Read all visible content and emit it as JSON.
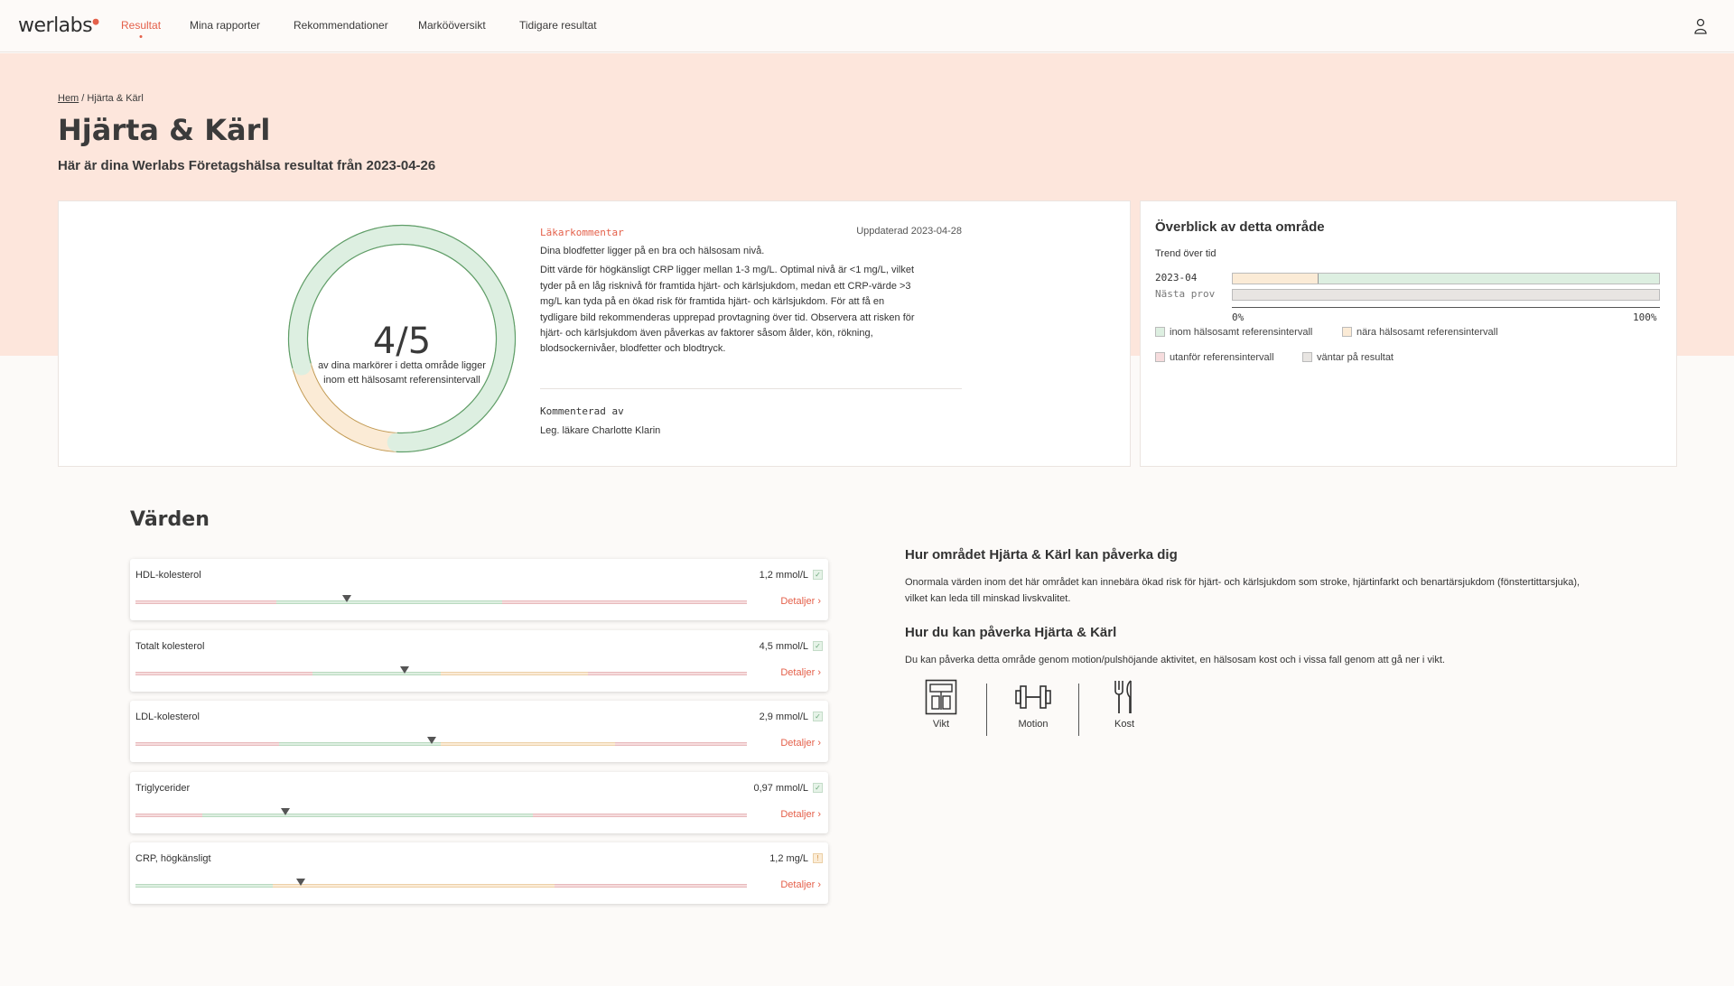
{
  "nav": {
    "logo": "werlabs",
    "items": [
      "Resultat",
      "Mina rapporter",
      "Rekommendationer",
      "Markööversikt",
      "Tidigare resultat"
    ]
  },
  "breadcrumb": {
    "home": "Hem",
    "separator": "/",
    "current": "Hjärta & Kärl"
  },
  "page": {
    "title": "Hjärta & Kärl",
    "subtitle": "Här är dina Werlabs Företagshälsa resultat från 2023-04-26"
  },
  "summary": {
    "score": "4/5",
    "score_label": "av dina markörer i detta område ligger inom ett hälsosamt referensintervall",
    "ring_fraction": 0.8
  },
  "comment": {
    "title": "Läkarkommentar",
    "updated": "Uppdaterad 2023-04-28",
    "paragraph1": "Dina blodfetter ligger på en bra och hälsosam nivå.",
    "paragraph2": "Ditt värde för högkänsligt CRP ligger mellan 1-3 mg/L. Optimal nivå är <1 mg/L, vilket tyder på en låg risknivå för framtida hjärt- och kärlsjukdom, medan ett CRP-värde >3 mg/L kan tyda på en ökad risk för framtida hjärt- och kärlsjukdom. För att få en tydligare bild rekommenderas upprepad provtagning över tid. Observera att risken för hjärt- och kärlsjukdom även påverkas av faktorer såsom ålder, kön, rökning, blodsockernivåer, blodfetter och blodtryck.",
    "by_label": "Kommenterad av",
    "doctor": "Leg. läkare Charlotte Klarin"
  },
  "overview": {
    "title": "Överblick av detta område",
    "trend_label": "Trend över tid",
    "rows": [
      {
        "label": "2023-04",
        "segments": [
          {
            "status": "near",
            "fraction": 0.2
          },
          {
            "status": "within",
            "fraction": 0.8
          }
        ]
      },
      {
        "label": "Nästa prov",
        "segments": [
          {
            "status": "pending",
            "fraction": 1.0
          }
        ]
      }
    ],
    "axis_min": "0%",
    "axis_max": "100%",
    "legend": {
      "within": "inom hälsosamt referensintervall",
      "near": "nära hälsosamt referensintervall",
      "outside": "utanför referensintervall",
      "pending": "väntar på resultat"
    },
    "colors": {
      "within": "#ddefe1",
      "near": "#fbebd6",
      "outside": "#f6dcdd",
      "pending": "#e8e5e2"
    }
  },
  "values": {
    "title": "Värden",
    "detail_label": "Detaljer",
    "items": [
      {
        "name": "HDL-kolesterol",
        "value": "1,2 mmol/L",
        "status": "ok",
        "ranges": [
          {
            "c": "r",
            "w": 0.23
          },
          {
            "c": "g",
            "w": 0.37
          },
          {
            "c": "r",
            "w": 0.4
          }
        ],
        "marker": 0.345
      },
      {
        "name": "Totalt kolesterol",
        "value": "4,5 mmol/L",
        "status": "ok",
        "ranges": [
          {
            "c": "r",
            "w": 0.29
          },
          {
            "c": "g",
            "w": 0.21
          },
          {
            "c": "o",
            "w": 0.24
          },
          {
            "c": "r",
            "w": 0.26
          }
        ],
        "marker": 0.44
      },
      {
        "name": "LDL-kolesterol",
        "value": "2,9 mmol/L",
        "status": "ok",
        "ranges": [
          {
            "c": "r",
            "w": 0.235
          },
          {
            "c": "g",
            "w": 0.265
          },
          {
            "c": "o",
            "w": 0.285
          },
          {
            "c": "r",
            "w": 0.215
          }
        ],
        "marker": 0.485
      },
      {
        "name": "Triglycerider",
        "value": "0,97 mmol/L",
        "status": "ok",
        "ranges": [
          {
            "c": "r",
            "w": 0.11
          },
          {
            "c": "g",
            "w": 0.54
          },
          {
            "c": "r",
            "w": 0.35
          }
        ],
        "marker": 0.245
      },
      {
        "name": "CRP, högkänsligt",
        "value": "1,2 mg/L",
        "status": "warn",
        "ranges": [
          {
            "c": "g",
            "w": 0.225
          },
          {
            "c": "o",
            "w": 0.46
          },
          {
            "c": "r",
            "w": 0.315
          }
        ],
        "marker": 0.27
      }
    ]
  },
  "info": {
    "heading1": "Hur området Hjärta & Kärl kan påverka dig",
    "text1": "Onormala värden inom det här området kan innebära ökad risk för hjärt- och kärlsjukdom som stroke, hjärtinfarkt och benartärsjukdom (fönstertittarsjuka), vilket kan leda till minskad livskvalitet.",
    "heading2": "Hur du kan påverka Hjärta & Kärl",
    "text2": "Du kan påverka detta område genom motion/pulshöjande aktivitet, en hälsosam kost och i vissa fall genom att gå ner i vikt.",
    "icons": [
      {
        "label": "Vikt",
        "icon": "scale-icon"
      },
      {
        "label": "Motion",
        "icon": "dumbbell-icon"
      },
      {
        "label": "Kost",
        "icon": "fork-knife-icon"
      }
    ]
  }
}
